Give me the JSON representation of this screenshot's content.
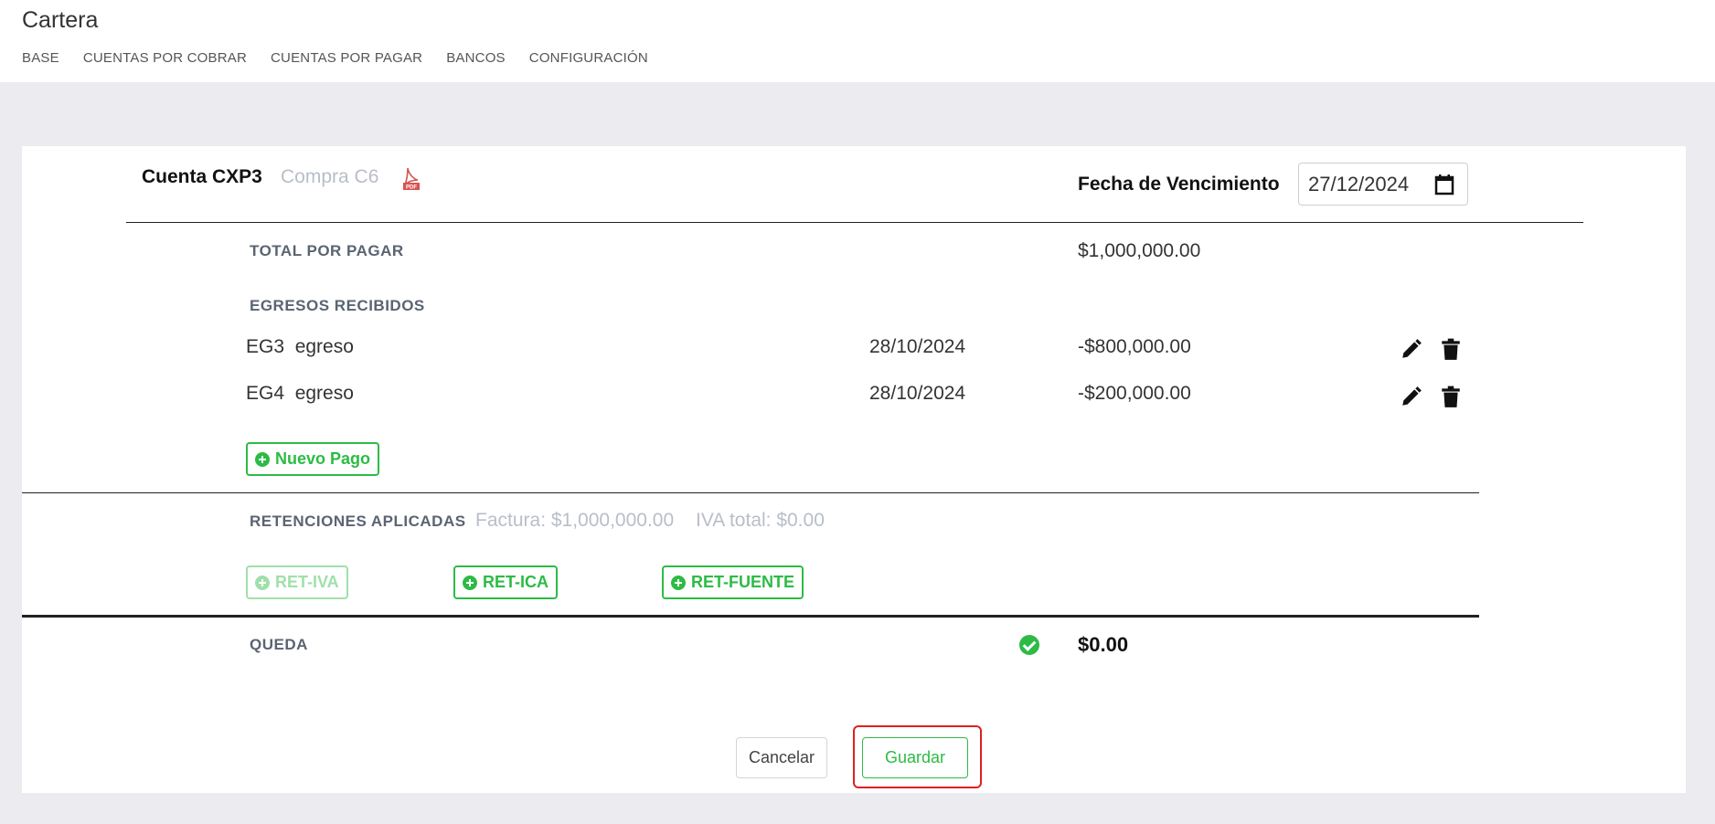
{
  "app": {
    "title": "Cartera"
  },
  "nav": [
    "BASE",
    "CUENTAS POR COBRAR",
    "CUENTAS POR PAGAR",
    "BANCOS",
    "CONFIGURACIÓN"
  ],
  "header": {
    "cuenta": "Cuenta CXP3",
    "compra": "Compra C6",
    "pdf_icon": "pdf-file-icon",
    "fecha_label": "Fecha de Vencimiento",
    "fecha_value": "27/12/2024"
  },
  "total": {
    "label": "TOTAL POR PAGAR",
    "value": "$1,000,000.00"
  },
  "egresos": {
    "label": "EGRESOS RECIBIDOS",
    "rows": [
      {
        "name": "EG3  egreso",
        "date": "28/10/2024",
        "amount": "-$800,000.00"
      },
      {
        "name": "EG4  egreso",
        "date": "28/10/2024",
        "amount": "-$200,000.00"
      }
    ],
    "new_button": "Nuevo Pago"
  },
  "retenciones": {
    "label": "RETENCIONES APLICADAS",
    "factura": "Factura: $1,000,000.00",
    "iva": "IVA total: $0.00",
    "buttons": [
      {
        "label": "RET-IVA",
        "enabled": false
      },
      {
        "label": "RET-ICA",
        "enabled": true
      },
      {
        "label": "RET-FUENTE",
        "enabled": true
      }
    ]
  },
  "queda": {
    "label": "QUEDA",
    "value": "$0.00",
    "status": "check-circle-icon"
  },
  "actions": {
    "cancel": "Cancelar",
    "save": "Guardar"
  },
  "colors": {
    "accent": "#2dbb45",
    "muted": "#b8bec8",
    "highlight": "#e02020"
  }
}
